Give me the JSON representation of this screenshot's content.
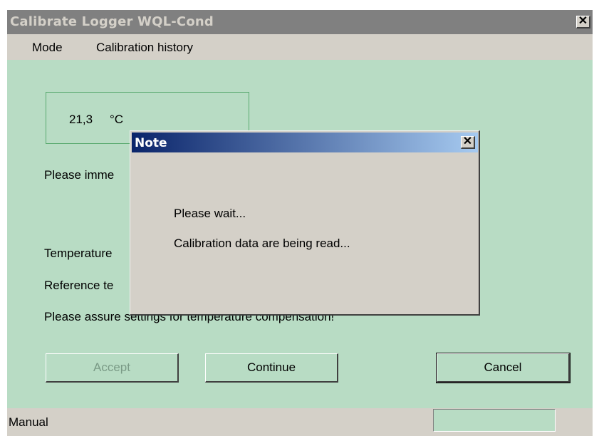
{
  "window": {
    "title": "Calibrate Logger WQL-Cond",
    "close_glyph": "✕"
  },
  "menu": {
    "items": [
      "Mode",
      "Calibration history"
    ]
  },
  "temperature": {
    "value": "21,3",
    "unit": "°C"
  },
  "labels": {
    "immerse": "Please imme",
    "temperature": "Temperature",
    "reference": "Reference te",
    "assure": "Please assure settings for temperature compensation!"
  },
  "buttons": {
    "accept": "Accept",
    "continue": "Continue",
    "cancel": "Cancel"
  },
  "status": {
    "text": "Manual"
  },
  "dialog": {
    "title": "Note",
    "close_glyph": "✕",
    "line1": "Please wait...",
    "line2": "Calibration data are being read..."
  },
  "colors": {
    "window_bg": "#b8dcc4",
    "title_inactive": "#808080",
    "dialog_title_start": "#0a246a",
    "dialog_title_end": "#a6caf0"
  }
}
